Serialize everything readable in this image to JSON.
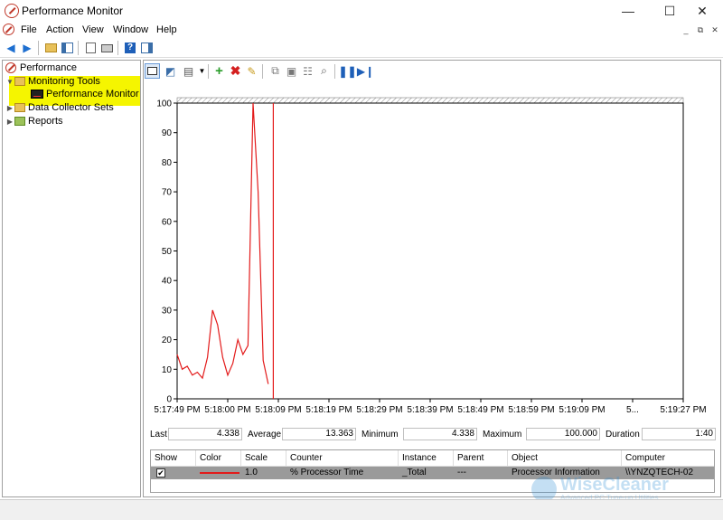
{
  "window": {
    "title": "Performance Monitor"
  },
  "window_controls": {
    "minimize": "—",
    "maximize": "☐",
    "close": "✕"
  },
  "menu": {
    "items": [
      "File",
      "Action",
      "View",
      "Window",
      "Help"
    ]
  },
  "mdi_controls": {
    "minimize": "_",
    "restore": "⧉",
    "close": "✕"
  },
  "tree": {
    "root": "Performance",
    "monitoring_tools": "Monitoring Tools",
    "performance_monitor": "Performance Monitor",
    "data_collector_sets": "Data Collector Sets",
    "reports": "Reports"
  },
  "stats": {
    "last_label": "Last",
    "last_value": "4.338",
    "average_label": "Average",
    "average_value": "13.363",
    "minimum_label": "Minimum",
    "minimum_value": "4.338",
    "maximum_label": "Maximum",
    "maximum_value": "100.000",
    "duration_label": "Duration",
    "duration_value": "1:40"
  },
  "legend": {
    "headers": [
      "Show",
      "Color",
      "Scale",
      "Counter",
      "Instance",
      "Parent",
      "Object",
      "Computer"
    ],
    "row": {
      "show": true,
      "scale": "1.0",
      "counter": "% Processor Time",
      "instance": "_Total",
      "parent": "---",
      "object": "Processor Information",
      "computer": "\\\\YNZQTECH-02"
    }
  },
  "watermark": {
    "title": "WiseCleaner",
    "subtitle": "Advanced PC Tune-up Utilities"
  },
  "colors": {
    "series": "#e31b1b",
    "highlight": "#f5f500",
    "accent": "#2f8fd6"
  },
  "chart_data": {
    "type": "line",
    "y_ticks": [
      "100",
      "90",
      "80",
      "70",
      "60",
      "50",
      "40",
      "30",
      "20",
      "10",
      "0"
    ],
    "ylim": [
      0,
      100
    ],
    "x_ticks": [
      "5:17:49 PM",
      "5:18:00 PM",
      "5:18:09 PM",
      "5:18:19 PM",
      "5:18:29 PM",
      "5:18:39 PM",
      "5:18:49 PM",
      "5:18:59 PM",
      "5:19:09 PM",
      "5...",
      "5:19:27 PM"
    ],
    "series": [
      {
        "values": [
          15,
          10,
          11,
          8,
          9,
          7,
          14,
          30,
          25,
          14,
          8,
          12,
          20,
          15,
          18,
          100,
          70,
          13,
          5
        ]
      }
    ],
    "time_cursor_index": 19,
    "sample_count": 101,
    "grid": false
  }
}
